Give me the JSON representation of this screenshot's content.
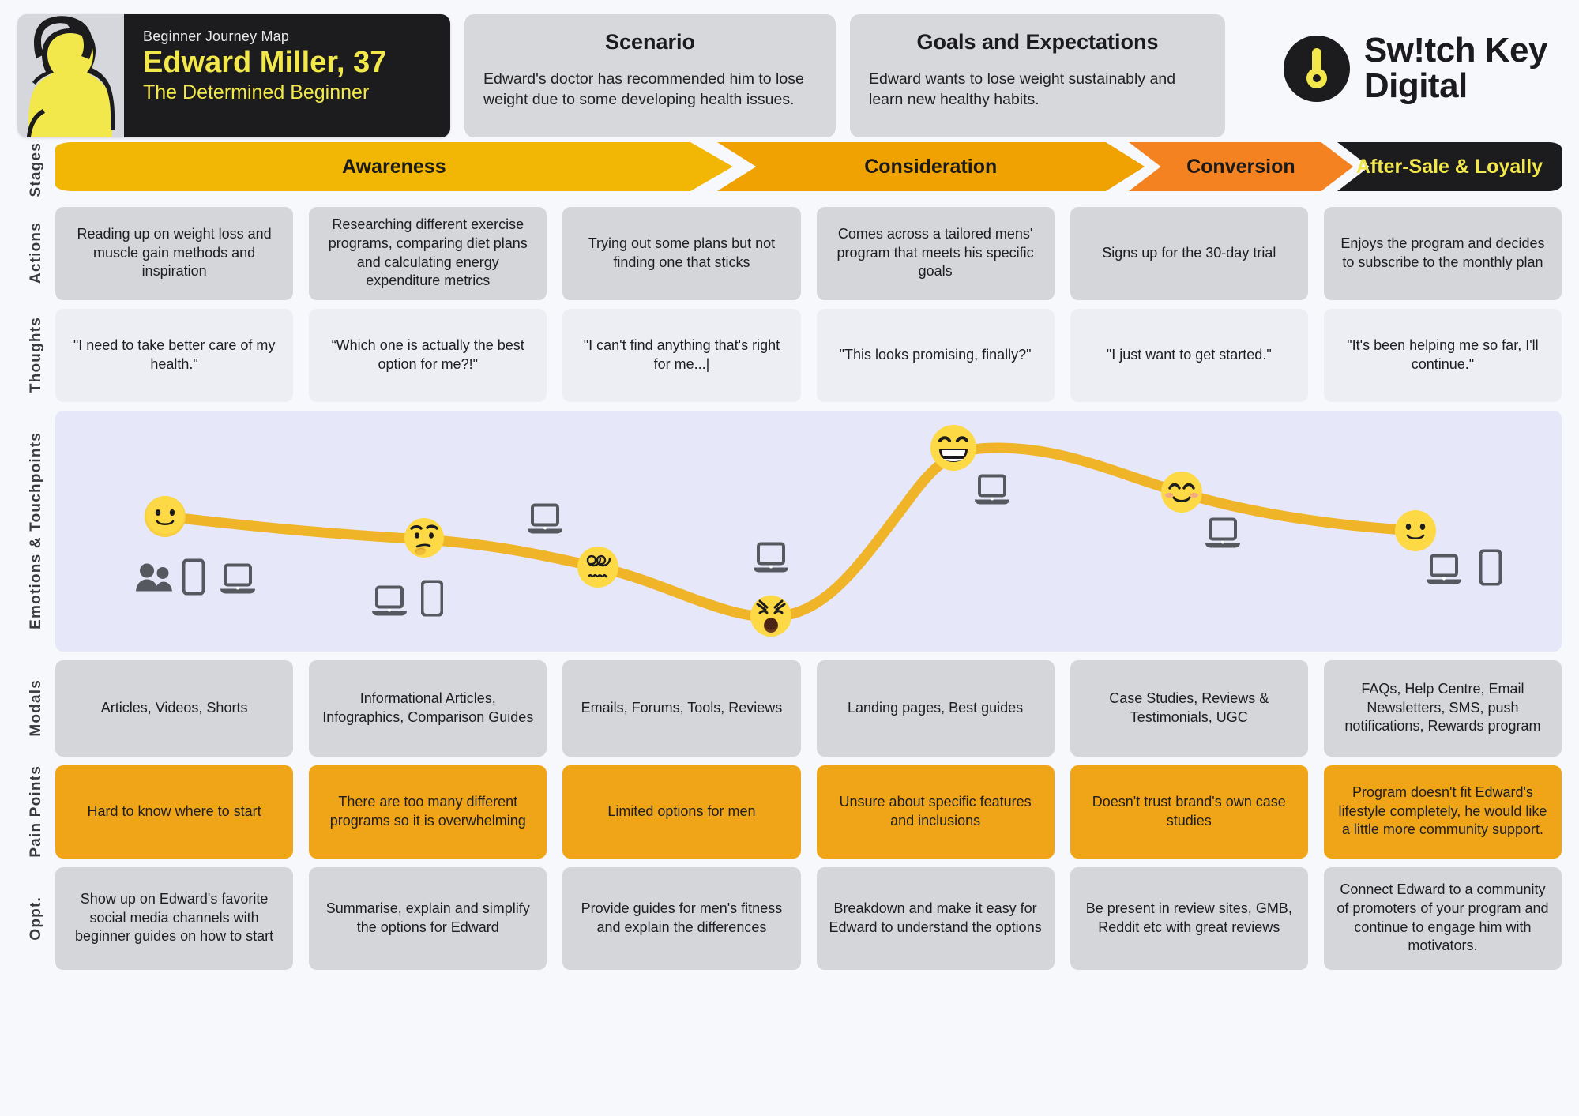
{
  "persona": {
    "kicker": "Beginner Journey Map",
    "name": "Edward Miller, 37",
    "tagline": "The Determined Beginner",
    "avatar_icon": "person-avatar-icon"
  },
  "scenario": {
    "title": "Scenario",
    "body": "Edward's doctor has recommended him to lose weight due to some developing health issues."
  },
  "goals": {
    "title": "Goals and Expectations",
    "body": "Edward wants to lose weight sustainably and learn new healthy habits."
  },
  "brand": {
    "line1": "Sw!tch Key",
    "line2": "Digital",
    "mark_icon": "key-circle-icon",
    "mark_bg": "#1c1c1e",
    "mark_fg": "#f2e84c"
  },
  "colors": {
    "awareness": "#f2b705",
    "consideration": "#f0a202",
    "conversion": "#f58220",
    "after_sale": "#1c1c1e",
    "after_sale_text": "#f2e84c",
    "pain": "#efa517",
    "card": "#d4d6da",
    "card_light": "#eceef4",
    "emotion_band": "#e7e7fa",
    "curve": "#f0b429",
    "page_bg": "#f7f8fc"
  },
  "rows": {
    "stages": {
      "label": "Stages",
      "items": [
        {
          "label": "Awareness",
          "flex": 3.17,
          "theme": "awareness"
        },
        {
          "label": "Consideration",
          "flex": 2.0,
          "theme": "consideration"
        },
        {
          "label": "Conversion",
          "flex": 1.05,
          "theme": "conversion"
        },
        {
          "label": "After-Sale & Loyally",
          "flex": 1.05,
          "theme": "after_sale"
        }
      ]
    },
    "actions": {
      "label": "Actions",
      "cells": [
        "Reading up on weight loss and muscle gain methods and inspiration",
        "Researching different exercise programs, comparing diet plans and calculating energy expenditure metrics",
        "Trying out some plans but not finding one that sticks",
        "Comes across a tailored mens' program that meets his specific goals",
        "Signs up for the 30-day trial",
        "Enjoys the program and decides to subscribe to the monthly plan"
      ]
    },
    "thoughts": {
      "label": "Thoughts",
      "cells": [
        "\"I need to take better care of my health.\"",
        "“Which one is actually the best option for me?!\"",
        "\"I can't find anything that's right for me...|",
        "\"This looks promising, finally?\"",
        "\"I just want to get started.\"",
        "\"It's been helping me so far, I'll continue.\""
      ]
    },
    "emotions": {
      "label": "Emotions & Touchpoints"
    },
    "modals": {
      "label": "Modals",
      "cells": [
        "Articles, Videos, Shorts",
        "Informational Articles, Infographics, Comparison Guides",
        "Emails, Forums, Tools, Reviews",
        "Landing pages, Best guides",
        "Case Studies, Reviews & Testimonials, UGC",
        "FAQs, Help Centre, Email Newsletters, SMS, push notifications, Rewards program"
      ]
    },
    "pain_points": {
      "label": "Pain Points",
      "cells": [
        "Hard to know where to start",
        "There are too many different programs so it is overwhelming",
        "Limited options for men",
        "Unsure about specific features and inclusions",
        "Doesn't trust brand's own case studies",
        "Program doesn't fit Edward's lifestyle completely, he would like a little more community support."
      ]
    },
    "opportunities": {
      "label": "Oppt.",
      "cells": [
        "Show up on Edward's favorite social media channels with beginner guides on how to start",
        "Summarise, explain and simplify the options for Edward",
        "Provide guides for men's fitness and explain the differences",
        "Breakdown and make it easy for Edward to understand the options",
        "Be present in review sites, GMB, Reddit etc with great reviews",
        "Connect Edward to a community of promoters of your program and continue to engage him with motivators."
      ]
    }
  },
  "chart_data": {
    "type": "line",
    "title": "Emotions & Touchpoints",
    "xlabel": "",
    "ylabel": "Emotion",
    "grid": false,
    "legend": "none",
    "x": [
      1,
      2,
      3,
      4,
      5,
      6,
      7,
      8
    ],
    "emotion_labels": [
      "slightly-smiling-face",
      "thinking-face",
      "dizzy-face",
      "anguished-face",
      "grinning-face",
      "smiling-face-with-smiling-eyes",
      "slightly-smiling-face"
    ],
    "points": [
      {
        "stage": "Awareness",
        "x_pct": 7.3,
        "y_pct": 44.0,
        "emoji": "slightly-smiling-face",
        "sentiment": 3,
        "touchpoints": [
          "people-icon",
          "phone-icon",
          "laptop-icon"
        ]
      },
      {
        "stage": "Awareness",
        "x_pct": 24.5,
        "y_pct": 53.5,
        "emoji": "thinking-face",
        "sentiment": 2,
        "touchpoints": [
          "laptop-icon",
          "phone-icon"
        ]
      },
      {
        "stage": "Consideration",
        "x_pct": 36.0,
        "y_pct": 65.0,
        "emoji": "dizzy-face",
        "sentiment": 1,
        "touchpoints": [
          "laptop-icon"
        ]
      },
      {
        "stage": "Consideration",
        "x_pct": 47.5,
        "y_pct": 85.5,
        "emoji": "anguished-face",
        "sentiment": 0,
        "touchpoints": [
          "laptop-icon"
        ]
      },
      {
        "stage": "Conversion",
        "x_pct": 59.6,
        "y_pct": 15.5,
        "emoji": "grinning-face",
        "sentiment": 5,
        "touchpoints": [
          "laptop-icon"
        ]
      },
      {
        "stage": "Conversion",
        "x_pct": 74.8,
        "y_pct": 34.0,
        "emoji": "smiling-face-with-smiling-eyes",
        "sentiment": 4,
        "touchpoints": [
          "laptop-icon"
        ]
      },
      {
        "stage": "After-Sale & Loyally",
        "x_pct": 90.3,
        "y_pct": 50.0,
        "emoji": "slightly-smiling-face",
        "sentiment": 3,
        "touchpoints": [
          "laptop-icon",
          "phone-icon"
        ]
      }
    ],
    "ylim": [
      0,
      5
    ],
    "series": [
      {
        "name": "Emotion curve",
        "values": [
          3,
          2,
          1,
          0,
          5,
          4,
          3
        ]
      }
    ]
  }
}
